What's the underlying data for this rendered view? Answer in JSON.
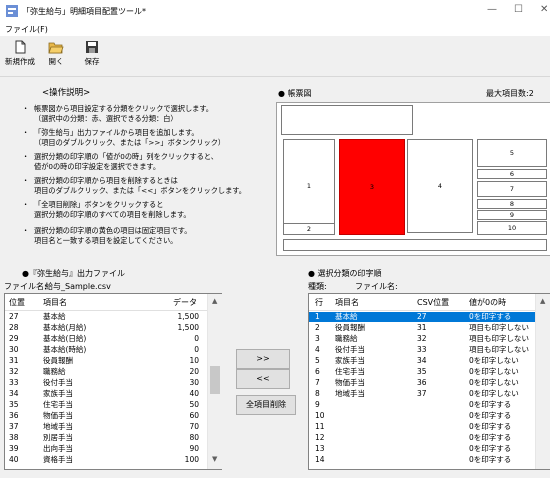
{
  "window": {
    "title": "「弥生給与」明細項目配置ツール*",
    "controls": [
      "—",
      "☐",
      "✕"
    ]
  },
  "menu": {
    "file": "ファイル(F)"
  },
  "toolbar": {
    "new_label": "新規作成",
    "open_label": "開く",
    "save_label": "保存"
  },
  "instructions": {
    "title": "<操作説明>",
    "items": [
      "帳票図から項目設定する分類をクリックで選択します。\n（選択中の分類：赤、選択できる分類：白）",
      "「弥生給与」出力ファイルから項目を追加します。\n（項目のダブルクリック、または「>>」ボタンクリック）",
      "選択分類の印字順の「値が0の時」列をクリックすると、\n値が0の時の印字設定を選択できます。",
      "選択分類の印字順から項目を削除するときは\n項目のダブルクリック、または「<<」ボタンをクリックします。",
      "「全項目削除」ボタンをクリックすると\n選択分類の印字順のすべての項目を削除します。",
      "選択分類の印字順の黄色の項目は固定項目です。\n項目名と一致する項目を設定してください。"
    ]
  },
  "preview": {
    "title": "● 帳票図",
    "max_label": "最大項目数:2",
    "labels": [
      "1",
      "2",
      "3",
      "4",
      "5",
      "6",
      "7",
      "8",
      "9",
      "10"
    ],
    "selected_color": "#ff0000"
  },
  "source": {
    "title": "●『弥生給与』出力ファイル",
    "file_label": "ファイル名:",
    "file_name": "給与_Sample.csv",
    "headers": {
      "pos": "位置",
      "name": "項目名",
      "data": "データ"
    },
    "rows": [
      {
        "pos": "27",
        "name": "基本給",
        "data": "1,500"
      },
      {
        "pos": "28",
        "name": "基本給(月給)",
        "data": "1,500"
      },
      {
        "pos": "29",
        "name": "基本給(日給)",
        "data": "0"
      },
      {
        "pos": "30",
        "name": "基本給(時給)",
        "data": "0"
      },
      {
        "pos": "31",
        "name": "役員報酬",
        "data": "10"
      },
      {
        "pos": "32",
        "name": "職務給",
        "data": "20"
      },
      {
        "pos": "33",
        "name": "役付手当",
        "data": "30"
      },
      {
        "pos": "34",
        "name": "家族手当",
        "data": "40"
      },
      {
        "pos": "35",
        "name": "住宅手当",
        "data": "50"
      },
      {
        "pos": "36",
        "name": "物価手当",
        "data": "60"
      },
      {
        "pos": "37",
        "name": "地域手当",
        "data": "70"
      },
      {
        "pos": "38",
        "name": "別居手当",
        "data": "80"
      },
      {
        "pos": "39",
        "name": "出向手当",
        "data": "90"
      },
      {
        "pos": "40",
        "name": "資格手当",
        "data": "100"
      }
    ]
  },
  "buttons": {
    "add": ">>",
    "remove": "<<",
    "remove_all": "全項目削除"
  },
  "order": {
    "title": "● 選択分類の印字順",
    "kind_label": "種類:",
    "file_label": "ファイル名:",
    "headers": {
      "row": "行",
      "name": "項目名",
      "csv": "CSV位置",
      "zero": "値が0の時"
    },
    "rows": [
      {
        "row": "1",
        "name": "基本給",
        "csv": "27",
        "zero": "0を印字する"
      },
      {
        "row": "2",
        "name": "役員報酬",
        "csv": "31",
        "zero": "項目も印字しない"
      },
      {
        "row": "3",
        "name": "職務給",
        "csv": "32",
        "zero": "項目も印字しない"
      },
      {
        "row": "4",
        "name": "役付手当",
        "csv": "33",
        "zero": "項目も印字しない"
      },
      {
        "row": "5",
        "name": "家族手当",
        "csv": "34",
        "zero": "0を印字しない"
      },
      {
        "row": "6",
        "name": "住宅手当",
        "csv": "35",
        "zero": "0を印字しない"
      },
      {
        "row": "7",
        "name": "物価手当",
        "csv": "36",
        "zero": "0を印字しない"
      },
      {
        "row": "8",
        "name": "地域手当",
        "csv": "37",
        "zero": "0を印字しない"
      },
      {
        "row": "9",
        "name": "",
        "csv": "",
        "zero": "0を印字する"
      },
      {
        "row": "10",
        "name": "",
        "csv": "",
        "zero": "0を印字する"
      },
      {
        "row": "11",
        "name": "",
        "csv": "",
        "zero": "0を印字する"
      },
      {
        "row": "12",
        "name": "",
        "csv": "",
        "zero": "0を印字する"
      },
      {
        "row": "13",
        "name": "",
        "csv": "",
        "zero": "0を印字する"
      },
      {
        "row": "14",
        "name": "",
        "csv": "",
        "zero": "0を印字する"
      }
    ]
  },
  "colors": {
    "selection": "#0078d7",
    "accent_red": "#ff0000"
  }
}
